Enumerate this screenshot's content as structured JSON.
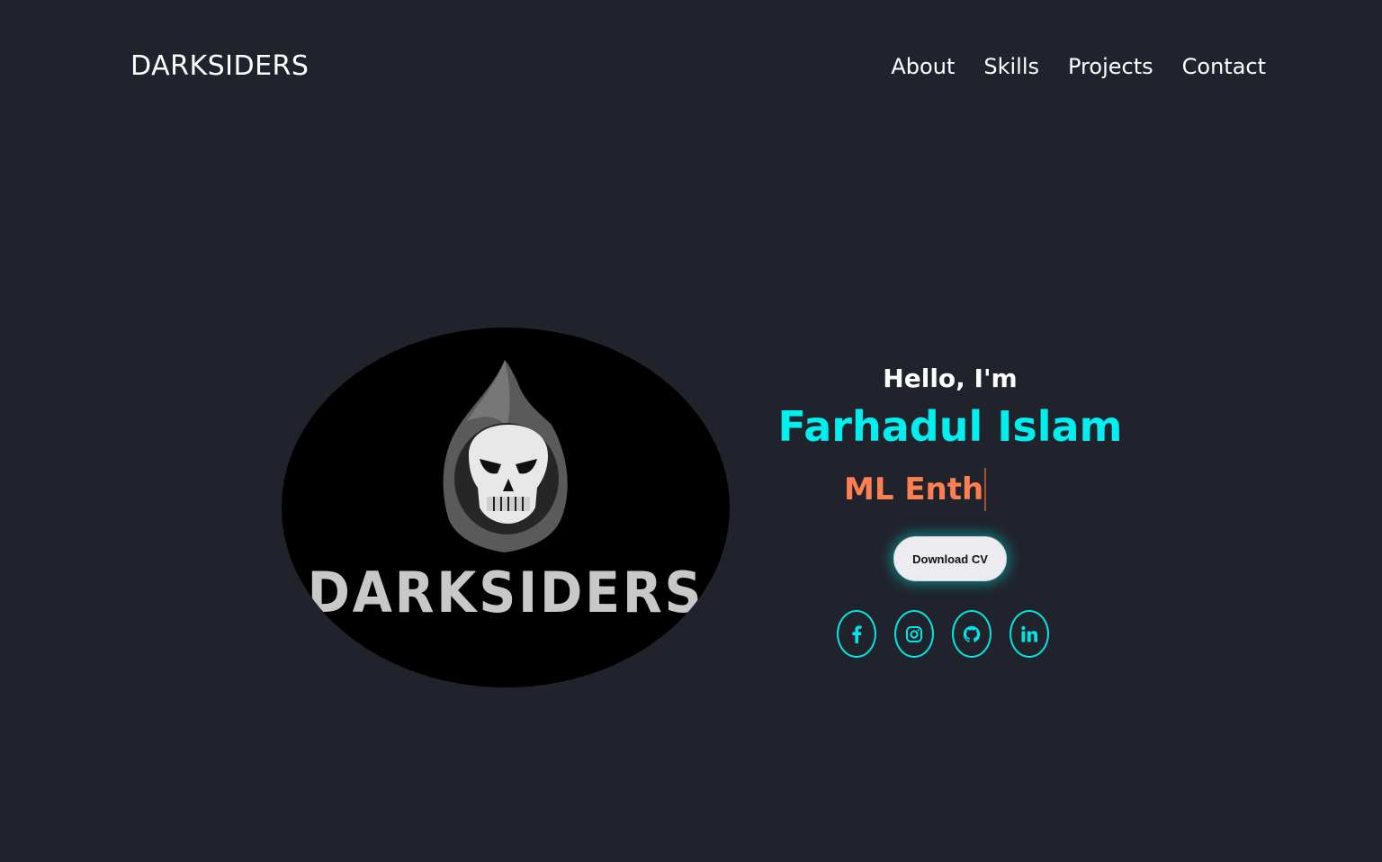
{
  "header": {
    "brand": "DARKSIDERS",
    "nav": [
      "About",
      "Skills",
      "Projects",
      "Contact"
    ]
  },
  "hero": {
    "avatar_alt": "DARKSIDERS",
    "greeting": "Hello, I'm",
    "name": "Farhadul Islam",
    "typed_text": "ML Enth",
    "cv_button": "Download CV",
    "socials": [
      "facebook-icon",
      "instagram-icon",
      "github-icon",
      "linkedin-icon"
    ]
  },
  "colors": {
    "background": "#20232c",
    "accent": "#00f0f0",
    "typed": "#ff7f50",
    "text": "#ffffff"
  }
}
